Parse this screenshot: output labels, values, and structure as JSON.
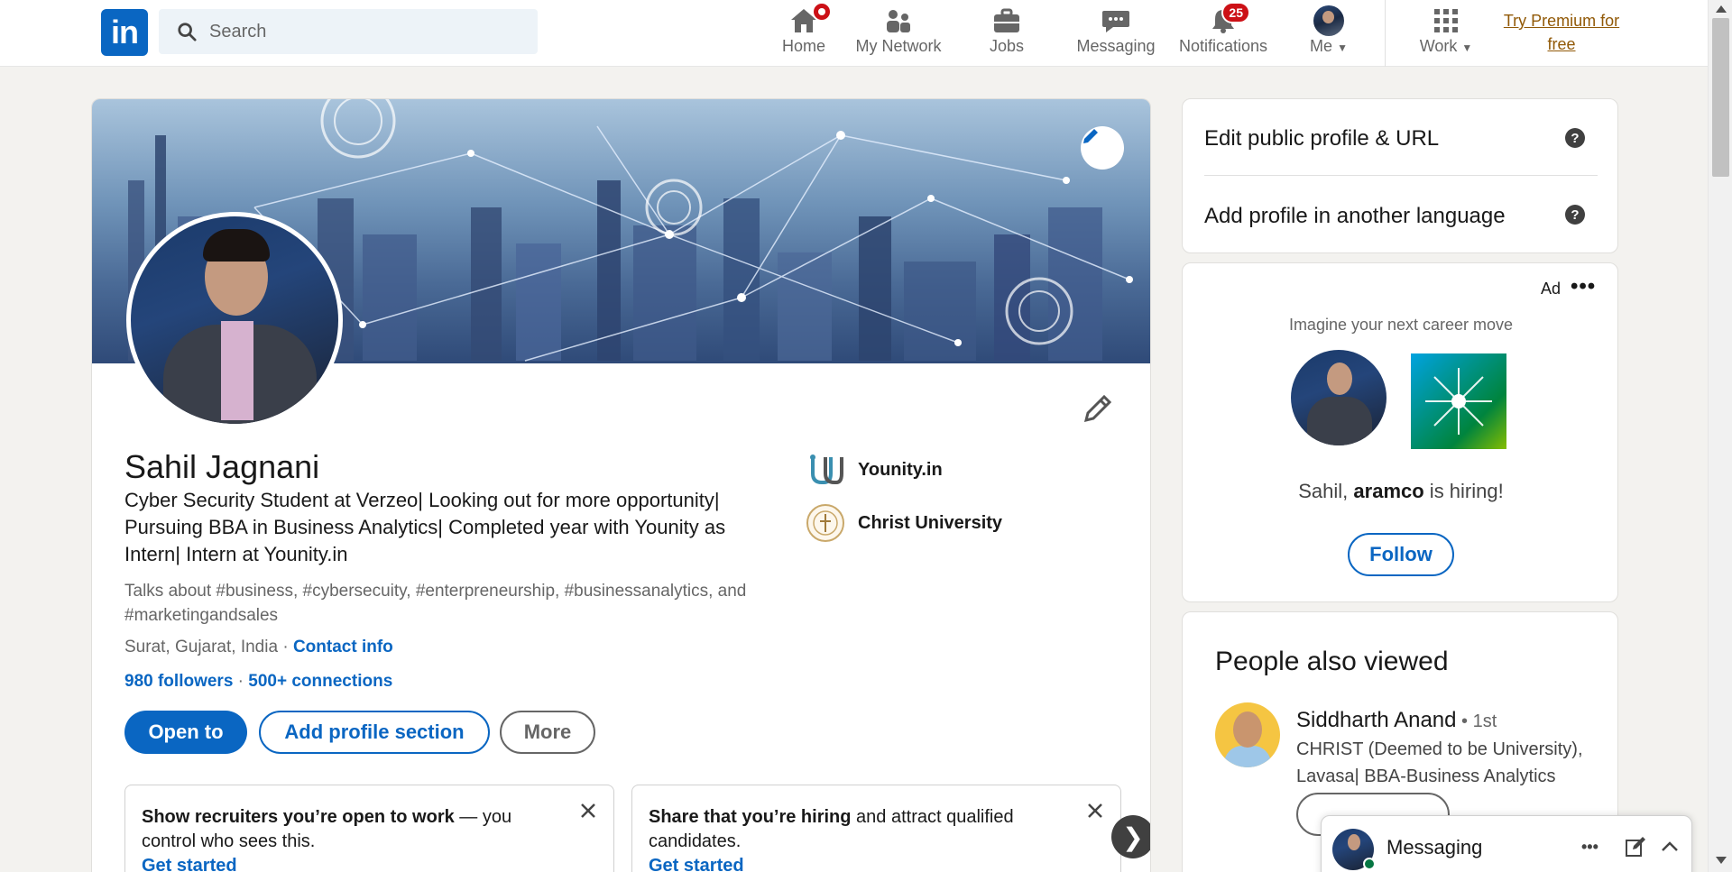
{
  "nav": {
    "logo_text": "in",
    "search_placeholder": "Search",
    "items": [
      {
        "label": "Home",
        "icon": "home-icon",
        "badge": ""
      },
      {
        "label": "My Network",
        "icon": "network-icon",
        "badge": ""
      },
      {
        "label": "Jobs",
        "icon": "briefcase-icon",
        "badge": ""
      },
      {
        "label": "Messaging",
        "icon": "messaging-icon",
        "badge": ""
      },
      {
        "label": "Notifications",
        "icon": "bell-icon",
        "badge": "25"
      },
      {
        "label": "Me",
        "icon": "avatar",
        "badge": ""
      },
      {
        "label": "Work",
        "icon": "grid-icon",
        "badge": ""
      }
    ],
    "premium_line1": "Try Premium for",
    "premium_line2": "free"
  },
  "profile": {
    "name": "Sahil Jagnani",
    "headline": "Cyber Security Student at Verzeo| Looking out for more opportunity| Pursuing BBA in Business Analytics| Completed year with Younity as Intern| Intern at Younity.in",
    "talks": "Talks about #business, #cybersecuity, #enterpreneurship, #businessanalytics, and #marketingandsales",
    "location": "Surat, Gujarat, India",
    "location_sep": " · ",
    "contact_info": "Contact info",
    "followers": "980 followers",
    "connections_sep": " · ",
    "connections": "500+ connections",
    "experience": [
      {
        "name": "Younity.in"
      },
      {
        "name": "Christ University"
      }
    ],
    "buttons": {
      "open_to": "Open to",
      "add_section": "Add profile section",
      "more": "More"
    },
    "promos": [
      {
        "bold": "Show recruiters you’re open to work",
        "rest": " — you control who sees this.",
        "link": "Get started"
      },
      {
        "bold": "Share that you’re hiring",
        "rest": " and attract qualified candidates.",
        "link": "Get started"
      }
    ],
    "carousel_next": "❯"
  },
  "sidebar": {
    "edit_public_profile": "Edit public profile & URL",
    "add_language": "Add profile in another language",
    "help_glyph": "?",
    "ad": {
      "label": "Ad",
      "dots": "•••",
      "text": "Imagine your next career move",
      "hiring_prefix": "Sahil, ",
      "hiring_company": "aramco",
      "hiring_suffix": " is hiring!",
      "follow": "Follow"
    },
    "people_also_viewed": {
      "title": "People also viewed",
      "people": [
        {
          "name": "Siddharth Anand",
          "degree": " • 1st",
          "desc": "CHRIST (Deemed to be University), Lavasa| BBA-Business Analytics"
        }
      ]
    }
  },
  "messaging": {
    "title": "Messaging",
    "dots": "•••"
  },
  "colors": {
    "brand": "#0a66c2",
    "badge": "#cc1016",
    "premium": "#915907",
    "online": "#057642"
  }
}
